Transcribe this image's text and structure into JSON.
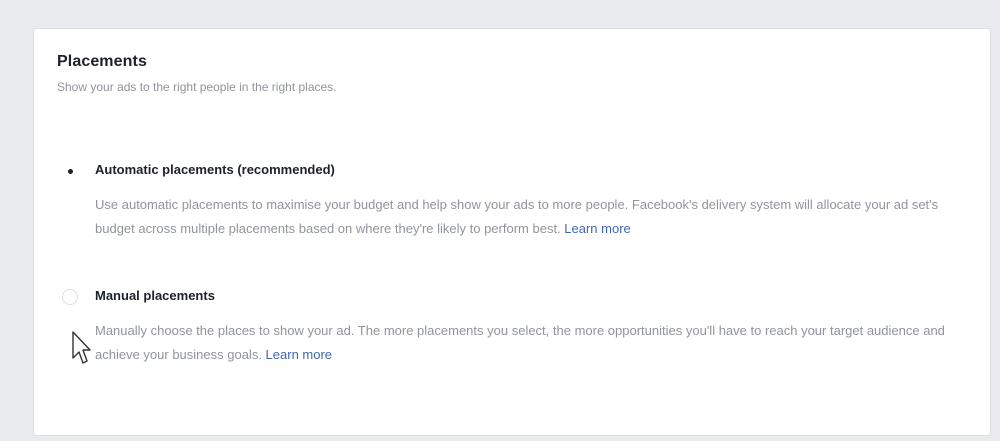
{
  "placements": {
    "title": "Placements",
    "subtitle": "Show your ads to the right people in the right places.",
    "options": [
      {
        "label": "Automatic placements (recommended)",
        "selected": true,
        "description": "Use automatic placements to maximise your budget and help show your ads to more people. Facebook's delivery system will allocate your ad set's budget across multiple placements based on where they're likely to perform best.",
        "learn_more": "Learn more"
      },
      {
        "label": "Manual placements",
        "selected": false,
        "description": "Manually choose the places to show your ad. The more placements you select, the more opportunities you'll have to reach your target audience and achieve your business goals.",
        "learn_more": "Learn more"
      }
    ]
  },
  "colors": {
    "page_background": "#e9ebee",
    "card_background": "#ffffff",
    "title_text": "#1d2129",
    "muted_text": "#90949c",
    "link": "#4267b2"
  },
  "icons": {
    "cursor": "mouse-pointer-icon"
  }
}
